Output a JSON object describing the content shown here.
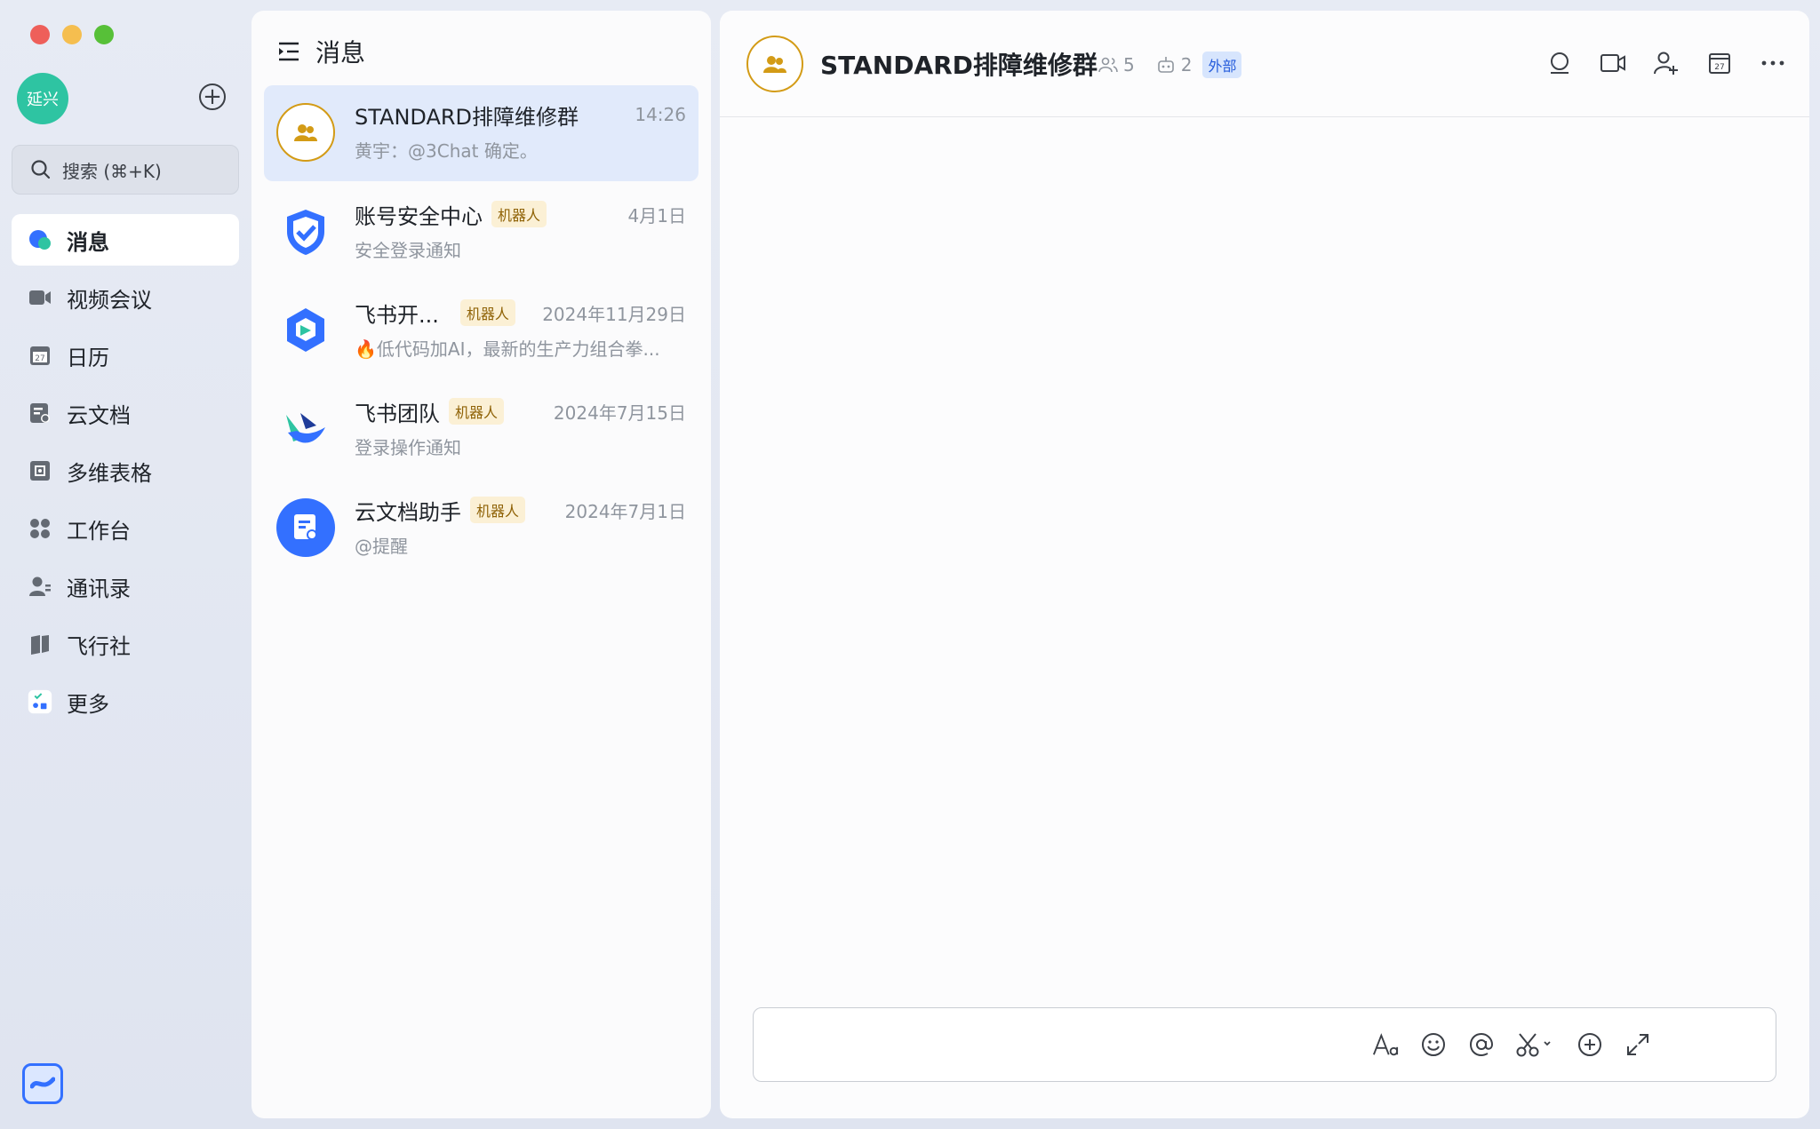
{
  "window": {
    "title": "消息"
  },
  "sidebar": {
    "avatar_text": "延兴",
    "search_placeholder": "搜索 (⌘+K)",
    "items": [
      {
        "label": "消息",
        "icon": "chat-bubble-icon",
        "active": true
      },
      {
        "label": "视频会议",
        "icon": "video-camera-icon"
      },
      {
        "label": "日历",
        "icon": "calendar-icon"
      },
      {
        "label": "云文档",
        "icon": "cloud-doc-icon"
      },
      {
        "label": "多维表格",
        "icon": "base-table-icon"
      },
      {
        "label": "工作台",
        "icon": "workplace-grid-icon"
      },
      {
        "label": "通讯录",
        "icon": "contacts-icon"
      },
      {
        "label": "飞行社",
        "icon": "flight-club-icon"
      },
      {
        "label": "更多",
        "icon": "more-apps-icon"
      }
    ]
  },
  "list": {
    "header": "消息",
    "conversations": [
      {
        "name": "STANDARD排障维修群",
        "time": "14:26",
        "preview": "黄宇：@3Chat 确定。",
        "bot": false,
        "active": true
      },
      {
        "name": "账号安全中心",
        "time": "4月1日",
        "preview": "安全登录通知",
        "bot": true
      },
      {
        "name": "飞书开...",
        "time": "2024年11月29日",
        "preview": "🔥低代码加AI，最新的生产力组合拳...",
        "bot": true
      },
      {
        "name": "飞书团队",
        "time": "2024年7月15日",
        "preview": "登录操作通知",
        "bot": true
      },
      {
        "name": "云文档助手",
        "time": "2024年7月1日",
        "preview": "@提醒",
        "bot": true
      }
    ],
    "bot_tag": "机器人"
  },
  "chat": {
    "title": "STANDARD排障维修群",
    "member_count": "5",
    "bot_count": "2",
    "external_tag": "外部"
  },
  "colors": {
    "accent": "#3370ff",
    "group_avatar": "#d39b16",
    "active_row": "#e1eafb",
    "bot_tag_bg": "#fbf0d5"
  }
}
